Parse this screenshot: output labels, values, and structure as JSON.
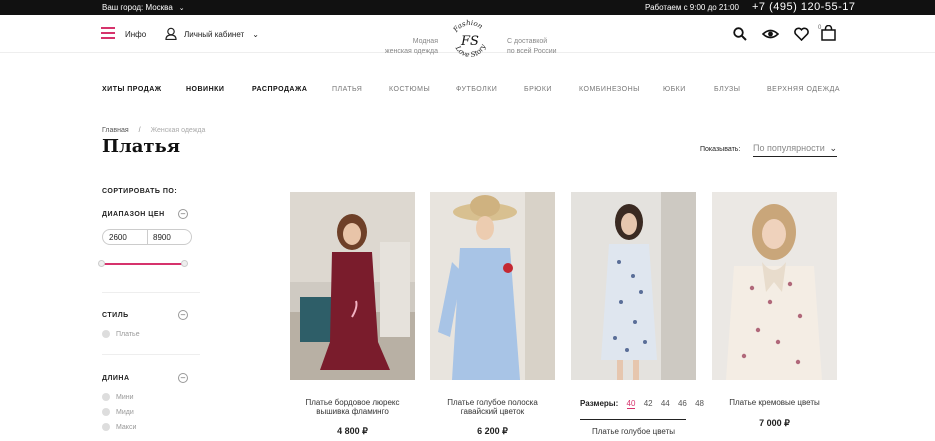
{
  "topbar": {
    "city": "Ваш город: Москва",
    "hours": "Работаем с 9:00 до 21:00",
    "phone": "+7 (495) 120-55-17"
  },
  "header": {
    "info": "Инфо",
    "cabinet": "Личный кабинет",
    "tagline_left_1": "Модная",
    "tagline_left_2": "женская одежда",
    "tagline_right_1": "С доставкой",
    "tagline_right_2": "по всей России",
    "logo_top": "Fashion",
    "logo_mid": "FS",
    "logo_bottom": "Love Story",
    "cart_count": "0"
  },
  "nav": [
    {
      "label": "ХИТЫ ПРОДАЖ",
      "bold": true
    },
    {
      "label": "НОВИНКИ",
      "bold": true
    },
    {
      "label": "РАСПРОДАЖА",
      "bold": true
    },
    {
      "label": "ПЛАТЬЯ",
      "bold": false
    },
    {
      "label": "КОСТЮМЫ",
      "bold": false
    },
    {
      "label": "ФУТБОЛКИ",
      "bold": false
    },
    {
      "label": "БРЮКИ",
      "bold": false
    },
    {
      "label": "КОМБИНЕЗОНЫ",
      "bold": false
    },
    {
      "label": "ЮБКИ",
      "bold": false
    },
    {
      "label": "БЛУЗЫ",
      "bold": false
    },
    {
      "label": "ВЕРХНЯЯ ОДЕЖДА",
      "bold": false
    }
  ],
  "breadcrumb": {
    "home": "Главная",
    "sep": "/",
    "current": "Женская одежда"
  },
  "page_title": "Платья",
  "sort": {
    "label": "Показывать:",
    "value": "По популярности"
  },
  "sidebar": {
    "sort_title": "СОРТИРОВАТЬ ПО:",
    "price_title": "ДИАПАЗОН ЦЕН",
    "price_from": "2600",
    "price_to": "8900",
    "style_title": "СТИЛЬ",
    "style_options": [
      "Платье"
    ],
    "length_title": "ДЛИНА",
    "length_options": [
      "Мини",
      "Миди",
      "Макси"
    ],
    "toggle_symbol": "–"
  },
  "products": [
    {
      "name_1": "Платье бордовое люрекс",
      "name_2": "вышивка фламинго",
      "price": "4 800 ₽"
    },
    {
      "name_1": "Платье голубое полоска",
      "name_2": "гавайский цветок",
      "price": "6 200 ₽"
    },
    {
      "name_1": "Платье голубое цветы",
      "name_2": "",
      "price": ""
    },
    {
      "name_1": "Платье кремовые цветы",
      "name_2": "",
      "price": "7 000 ₽"
    }
  ],
  "sizes": {
    "label": "Размеры:",
    "values": [
      "40",
      "42",
      "44",
      "46",
      "48"
    ],
    "active": "40"
  },
  "colors": {
    "accent": "#d6336c",
    "topbar": "#111111"
  }
}
